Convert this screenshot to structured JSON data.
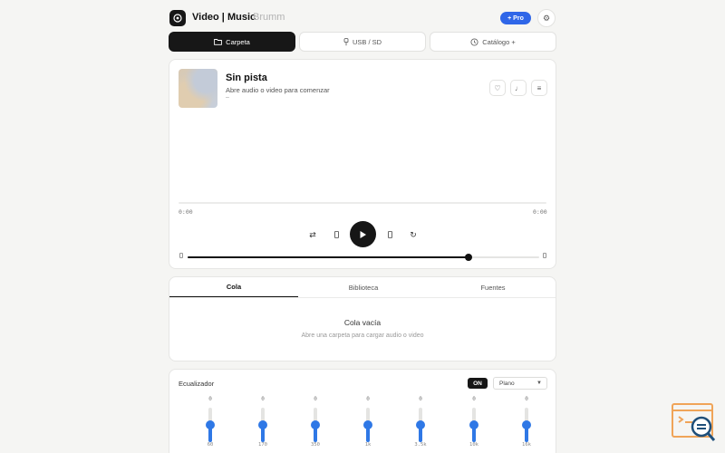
{
  "header": {
    "title": "Video | Music",
    "brand": "Brumm",
    "pro_label": "+ Pro"
  },
  "source_tabs": [
    {
      "label": "Carpeta",
      "icon": "folder-icon",
      "active": true
    },
    {
      "label": "USB / SD",
      "icon": "usb-icon",
      "active": false
    },
    {
      "label": "Catálogo +",
      "icon": "catalog-icon",
      "active": false
    }
  ],
  "player": {
    "title": "Sin pista",
    "subtitle": "Abre audio o video para comenzar",
    "meta": "–",
    "time_current": "0:00",
    "time_total": "0:00",
    "progress": 0,
    "volume": 0.8
  },
  "queue": {
    "tabs": [
      "Cola",
      "Biblioteca",
      "Fuentes"
    ],
    "active_tab": "Cola",
    "empty_title": "Cola vacía",
    "empty_subtitle": "Abre una carpeta para cargar audio o video"
  },
  "eq": {
    "title": "Ecualizador",
    "toggle": "ON",
    "preset": "Plano",
    "bands": [
      {
        "label": "60",
        "value": "0",
        "level": 0.5
      },
      {
        "label": "170",
        "value": "0",
        "level": 0.5
      },
      {
        "label": "350",
        "value": "0",
        "level": 0.5
      },
      {
        "label": "1k",
        "value": "0",
        "level": 0.5
      },
      {
        "label": "3.5k",
        "value": "0",
        "level": 0.5
      },
      {
        "label": "10k",
        "value": "0",
        "level": 0.5
      },
      {
        "label": "16k",
        "value": "0",
        "level": 0.5
      }
    ]
  },
  "colors": {
    "accent": "#2f66e8",
    "eq_blue": "#2f78e6",
    "dark": "#161616",
    "background": "#f5f5f3"
  }
}
